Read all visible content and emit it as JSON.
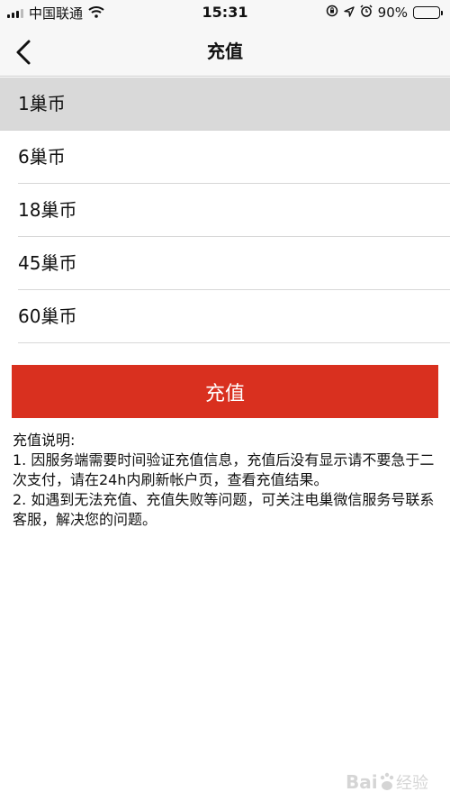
{
  "status_bar": {
    "carrier": "中国联通",
    "time": "15:31",
    "battery": "90%",
    "battery_level": 0.9
  },
  "nav": {
    "title": "充值"
  },
  "options": [
    {
      "label": "1巢币",
      "selected": true
    },
    {
      "label": "6巢币",
      "selected": false
    },
    {
      "label": "18巢币",
      "selected": false
    },
    {
      "label": "45巢币",
      "selected": false
    },
    {
      "label": "60巢币",
      "selected": false
    }
  ],
  "recharge_button": {
    "label": "充值",
    "color": "#d9301f"
  },
  "notes": {
    "heading": "充值说明:",
    "item1": "1. 因服务端需要时间验证充值信息，充值后没有显示请不要急于二次支付，请在24h内刷新帐户页，查看充值结果。",
    "item2": "2. 如遇到无法充值、充值失败等问题，可关注电巢微信服务号联系客服，解决您的问题。"
  },
  "watermark": {
    "text": "Bai 经验"
  }
}
